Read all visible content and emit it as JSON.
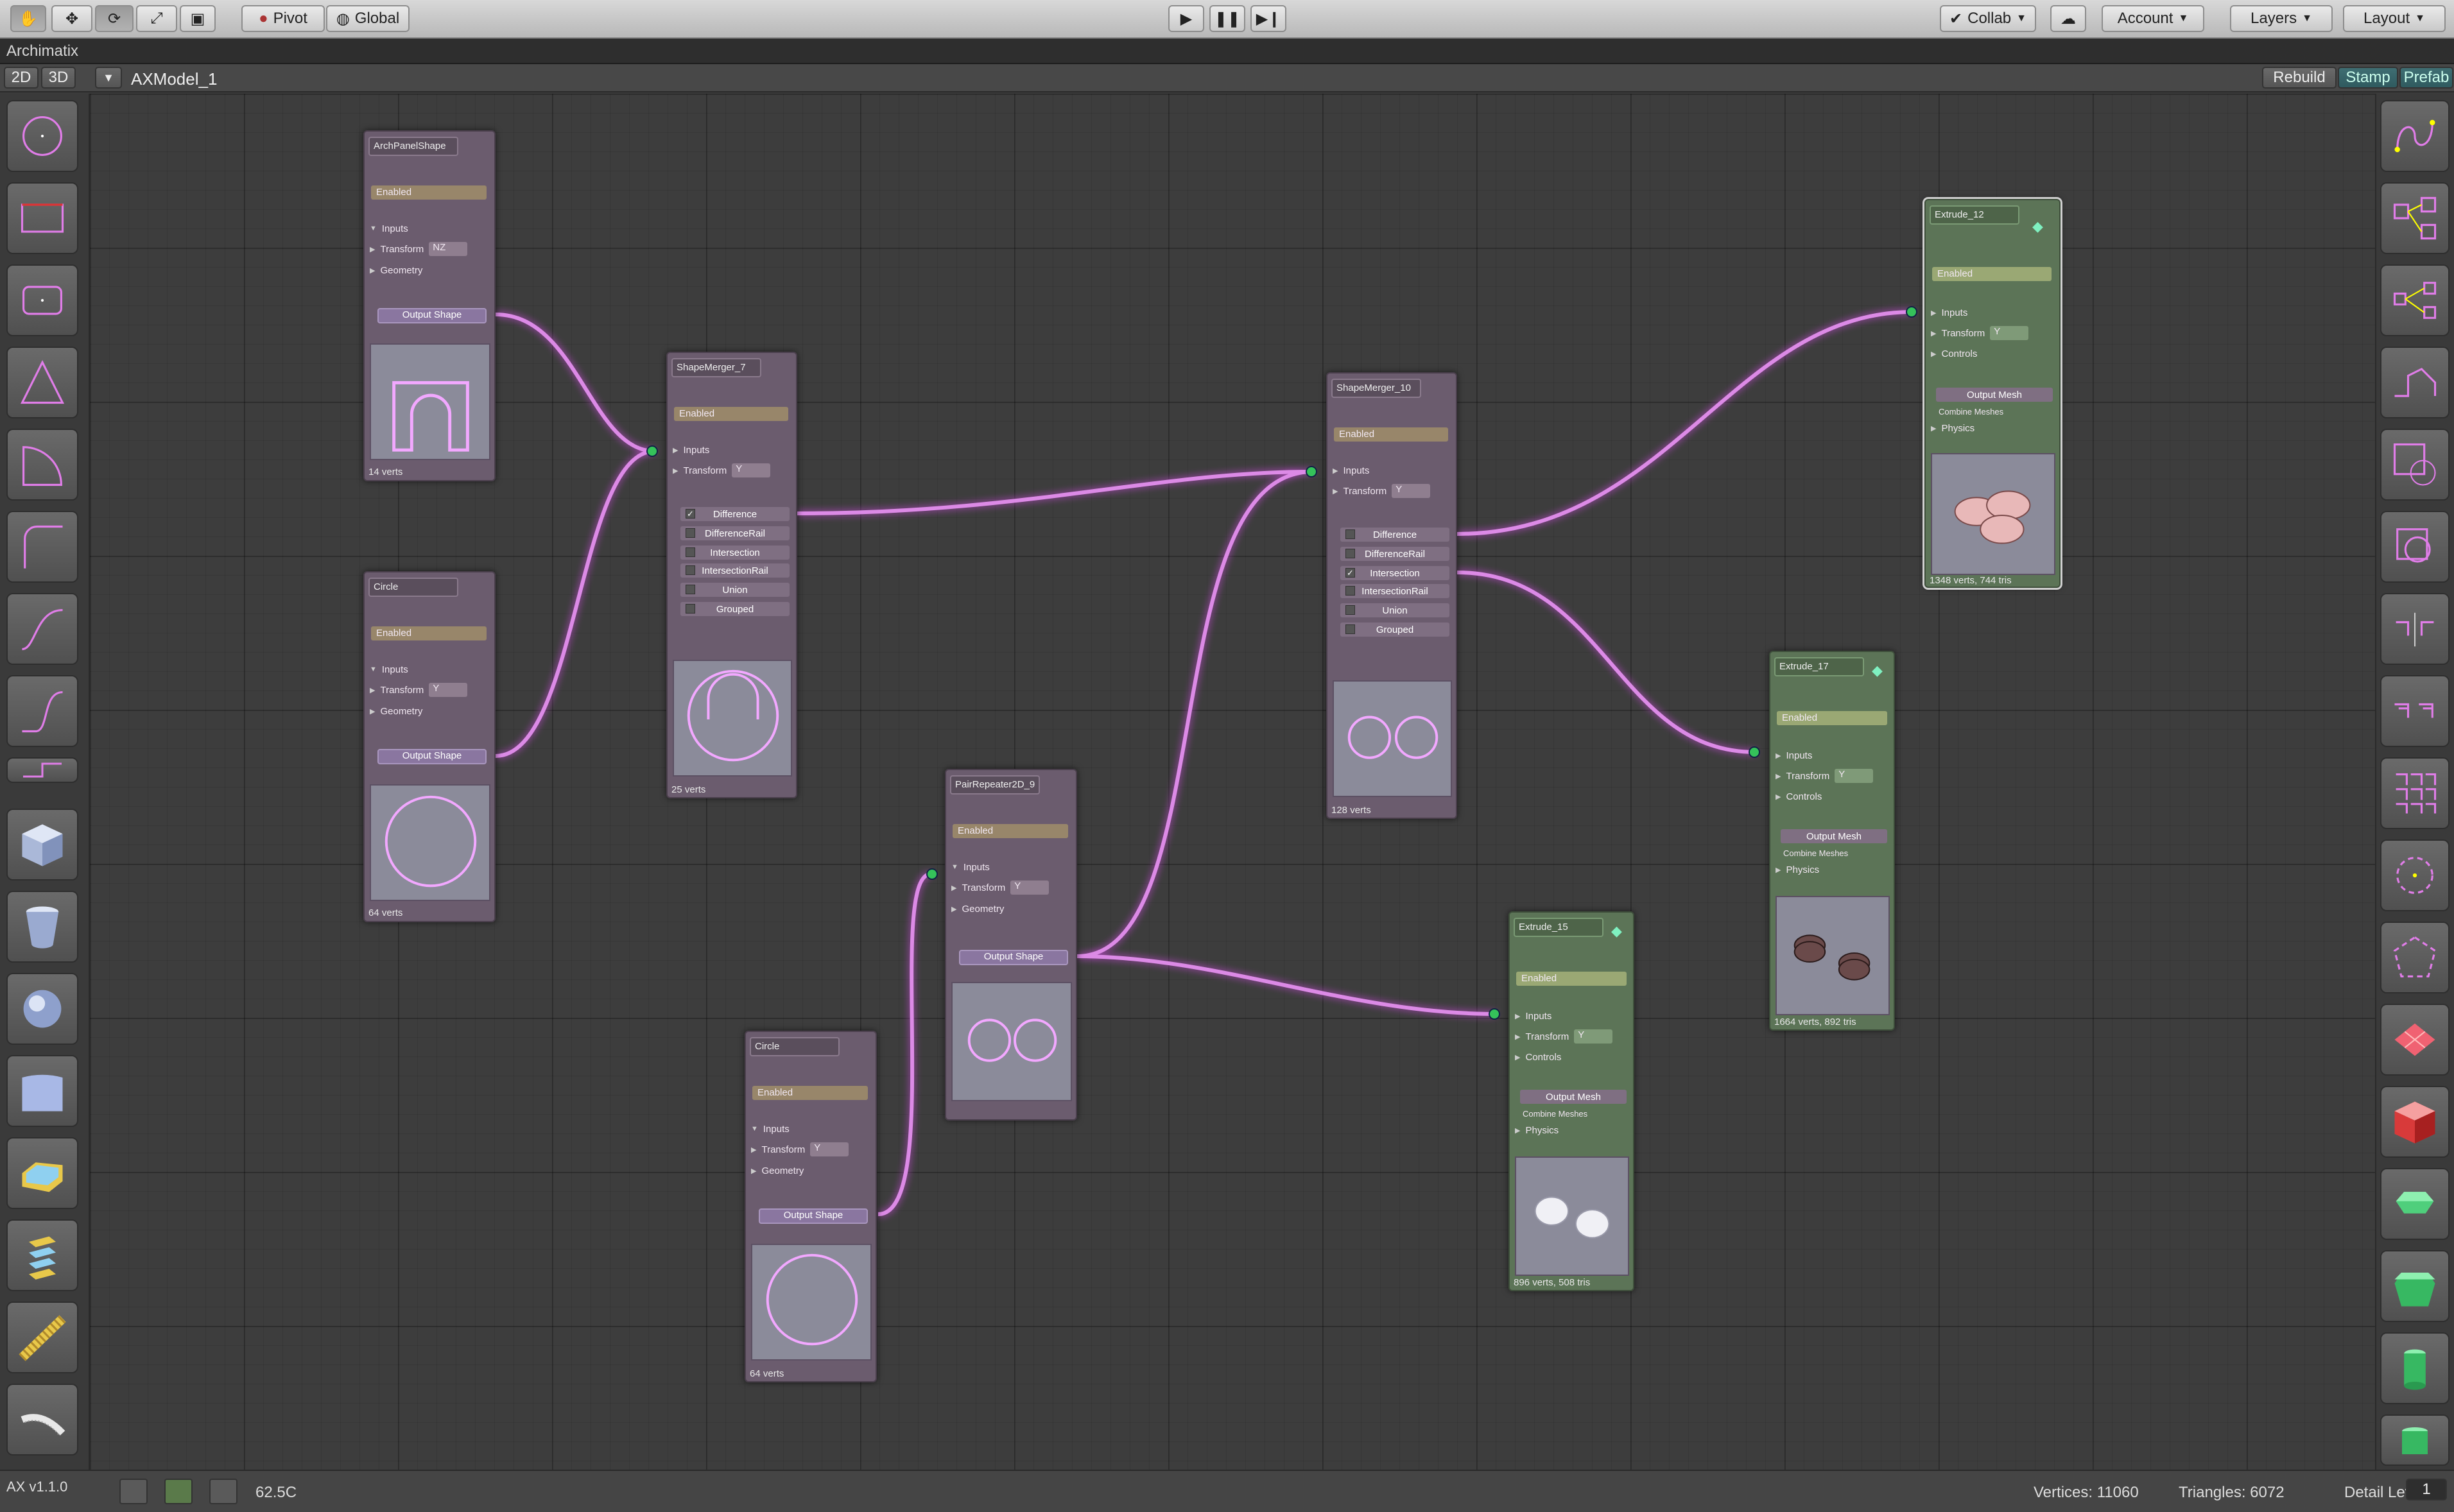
{
  "toolbar": {
    "pivot": "Pivot",
    "global": "Global",
    "collab": "Collab",
    "account": "Account",
    "layers": "Layers",
    "layout": "Layout"
  },
  "window": {
    "title": "Archimatix"
  },
  "editor": {
    "mode_2d": "2D",
    "mode_3d": "3D",
    "model_name": "AXModel_1",
    "rebuild": "Rebuild",
    "stamp": "Stamp",
    "prefab": "Prefab"
  },
  "nodes": {
    "arch_panel": {
      "title": "ArchPanelShape",
      "enabled": "Enabled",
      "inputs": "Inputs",
      "transform": "Transform",
      "transform_val": "NZ",
      "geometry": "Geometry",
      "output": "Output Shape",
      "verts": "14 verts"
    },
    "circle_a": {
      "title": "Circle",
      "enabled": "Enabled",
      "inputs": "Inputs",
      "transform": "Transform",
      "transform_val": "Y",
      "geometry": "Geometry",
      "output": "Output Shape",
      "verts": "64 verts"
    },
    "merger7": {
      "title": "ShapeMerger_7",
      "enabled": "Enabled",
      "inputs": "Inputs",
      "transform": "Transform",
      "transform_val": "Y",
      "ops": [
        "Difference",
        "DifferenceRail",
        "Intersection",
        "IntersectionRail",
        "Union",
        "Grouped"
      ],
      "verts": "25 verts"
    },
    "repeater": {
      "title": "PairRepeater2D_9",
      "enabled": "Enabled",
      "inputs": "Inputs",
      "transform": "Transform",
      "transform_val": "Y",
      "geometry": "Geometry",
      "output": "Output Shape"
    },
    "circle_b": {
      "title": "Circle",
      "enabled": "Enabled",
      "inputs": "Inputs",
      "transform": "Transform",
      "transform_val": "Y",
      "geometry": "Geometry",
      "output": "Output Shape",
      "verts": "64 verts"
    },
    "merger10": {
      "title": "ShapeMerger_10",
      "enabled": "Enabled",
      "inputs": "Inputs",
      "transform": "Transform",
      "transform_val": "Y",
      "ops": [
        "Difference",
        "DifferenceRail",
        "Intersection",
        "IntersectionRail",
        "Union",
        "Grouped"
      ],
      "verts": "128 verts"
    },
    "extrude12": {
      "title": "Extrude_12",
      "enabled": "Enabled",
      "inputs": "Inputs",
      "transform": "Transform",
      "transform_val": "Y",
      "controls": "Controls",
      "output_mesh": "Output Mesh",
      "combine": "Combine Meshes",
      "physics": "Physics",
      "verts": "1348 verts, 744 tris"
    },
    "extrude17": {
      "title": "Extrude_17",
      "enabled": "Enabled",
      "inputs": "Inputs",
      "transform": "Transform",
      "transform_val": "Y",
      "controls": "Controls",
      "output_mesh": "Output Mesh",
      "combine": "Combine Meshes",
      "physics": "Physics",
      "verts": "1664 verts, 892 tris"
    },
    "extrude15": {
      "title": "Extrude_15",
      "enabled": "Enabled",
      "inputs": "Inputs",
      "transform": "Transform",
      "transform_val": "Y",
      "controls": "Controls",
      "output_mesh": "Output Mesh",
      "combine": "Combine Meshes",
      "physics": "Physics",
      "verts": "896 verts, 508 tris"
    }
  },
  "status": {
    "version": "AX v1.1.0",
    "zoom": "62.5C",
    "vertices": "Vertices: 11060",
    "triangles": "Triangles: 6072",
    "detail_label": "Detail Level",
    "detail_value": "1"
  },
  "colors": {
    "wire": "#d98ee6",
    "node_shape": "#6b5c6e",
    "node_mesh": "#5c7457",
    "accent_teal": "#3f6e73"
  }
}
